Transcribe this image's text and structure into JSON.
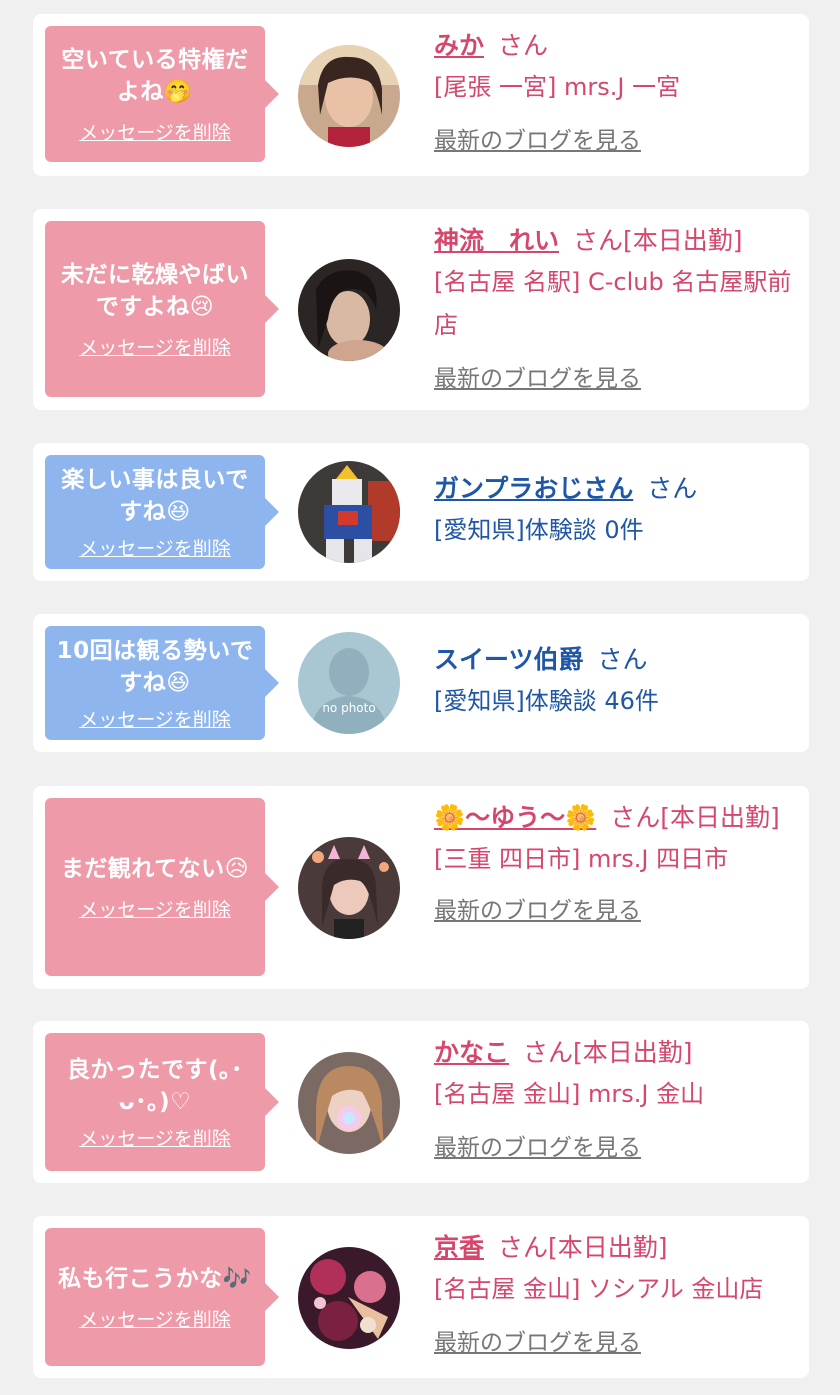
{
  "common": {
    "delete_label": "メッセージを削除",
    "blog_label": "最新のブログを見る",
    "san": "さん"
  },
  "colors": {
    "pink_bubble": "#ee9aa8",
    "blue_bubble": "#8eb5ee",
    "pink_text": "#d6476c",
    "blue_text": "#1f56a6",
    "background": "#f0f0f0"
  },
  "items": [
    {
      "message": "空いている特権だよね🤭",
      "name": "みか",
      "suffix": "さん",
      "shop": "[尾張 一宮] mrs.J 一宮",
      "type": "cast"
    },
    {
      "message": "未だに乾燥やばいですよね😢",
      "name": "神流　れい",
      "suffix": "さん[本日出勤]",
      "shop": "[名古屋 名駅] C-club 名古屋駅前店",
      "type": "cast"
    },
    {
      "message": "楽しい事は良いですね😆",
      "name": "ガンプラおじさん",
      "suffix": "さん",
      "shop": "[愛知県]体験談 0件",
      "type": "user"
    },
    {
      "message": "10回は観る勢いですね😆",
      "name": "スイーツ伯爵",
      "suffix": "さん",
      "shop": "[愛知県]体験談 46件",
      "type": "user",
      "avatar_label": "no photo"
    },
    {
      "message": "まだ観れてない😥",
      "name": "🌼〜ゆう〜🌼",
      "suffix": "さん[本日出勤]",
      "shop": "[三重 四日市] mrs.J 四日市",
      "type": "cast"
    },
    {
      "message": "良かったです(｡･ᴗ･｡)♡",
      "name": "かなこ",
      "suffix": "さん[本日出勤]",
      "shop": "[名古屋 金山] mrs.J 金山",
      "type": "cast"
    },
    {
      "message": "私も行こうかな🎶",
      "name": "京香",
      "suffix": "さん[本日出勤]",
      "shop": "[名古屋 金山] ソシアル 金山店",
      "type": "cast"
    }
  ]
}
